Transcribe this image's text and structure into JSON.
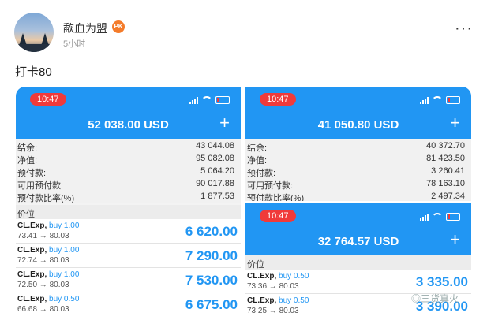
{
  "post": {
    "username": "歃血为盟",
    "badge": "PK",
    "time": "5小时",
    "text": "打卡80",
    "more": "···"
  },
  "shots": {
    "left": {
      "clock": "10:47",
      "balance": "52 038.00 USD",
      "plus": "+",
      "rows": [
        {
          "label": "结余:",
          "value": "43 044.08"
        },
        {
          "label": "净值:",
          "value": "95 082.08"
        },
        {
          "label": "预付款:",
          "value": "5 064.20"
        },
        {
          "label": "可用预付款:",
          "value": "90 017.88"
        },
        {
          "label": "预付款比率(%)",
          "value": "1 877.53"
        }
      ],
      "section": "价位",
      "trades": [
        {
          "symbol": "CL.Exp,",
          "side": "buy 1.00",
          "prices": "73.41 → 80.03",
          "profit": "6 620.00"
        },
        {
          "symbol": "CL.Exp,",
          "side": "buy 1.00",
          "prices": "72.74 → 80.03",
          "profit": "7 290.00"
        },
        {
          "symbol": "CL.Exp,",
          "side": "buy 1.00",
          "prices": "72.50 → 80.03",
          "profit": "7 530.00"
        },
        {
          "symbol": "CL.Exp,",
          "side": "buy 0.50",
          "prices": "66.68 → 80.03",
          "profit": "6 675.00"
        }
      ]
    },
    "right_top": {
      "clock": "10:47",
      "balance": "41 050.80 USD",
      "plus": "+",
      "rows": [
        {
          "label": "结余:",
          "value": "40 372.70"
        },
        {
          "label": "净值:",
          "value": "81 423.50"
        },
        {
          "label": "预付款:",
          "value": "3 260.41"
        },
        {
          "label": "可用预付款:",
          "value": "78 163.10"
        },
        {
          "label": "预付款比率(%)",
          "value": "2 497.34"
        }
      ]
    },
    "right_bottom": {
      "clock": "10:47",
      "balance": "32 764.57 USD",
      "plus": "+",
      "section": "价位",
      "trades": [
        {
          "symbol": "CL.Exp,",
          "side": "buy 0.50",
          "prices": "73.36 → 80.03",
          "profit": "3 335.00"
        },
        {
          "symbol": "CL.Exp,",
          "side": "buy 0.50",
          "prices": "73.25 → 80.03",
          "profit": "3 390.00"
        }
      ]
    }
  },
  "watermark": "◎三货真火"
}
